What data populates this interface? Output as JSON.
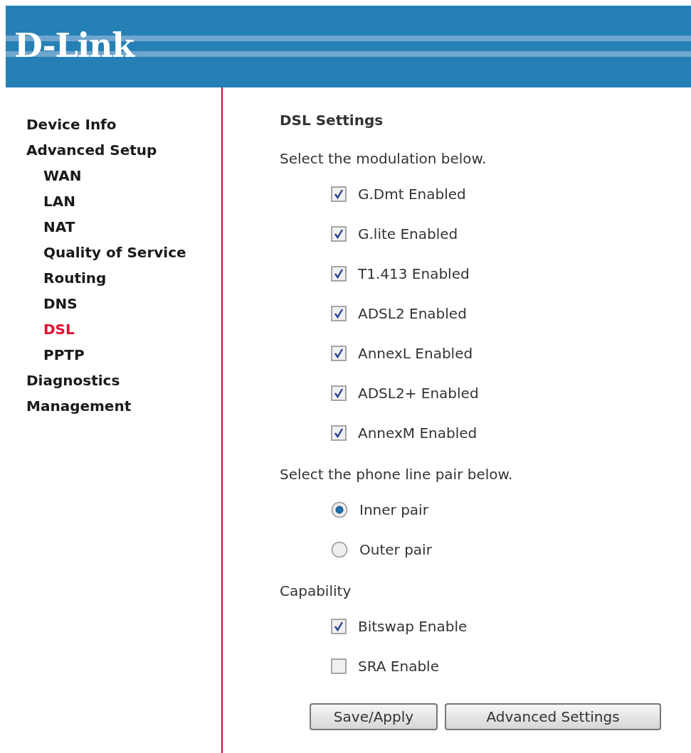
{
  "header": {
    "logo": "D-Link"
  },
  "sidebar": {
    "items": [
      {
        "label": "Device Info",
        "selected": false
      },
      {
        "label": "Advanced Setup",
        "selected": false,
        "children": [
          {
            "label": "WAN",
            "selected": false
          },
          {
            "label": "LAN",
            "selected": false
          },
          {
            "label": "NAT",
            "selected": false
          },
          {
            "label": "Quality of Service",
            "selected": false
          },
          {
            "label": "Routing",
            "selected": false
          },
          {
            "label": "DNS",
            "selected": false
          },
          {
            "label": "DSL",
            "selected": true
          },
          {
            "label": "PPTP",
            "selected": false
          }
        ]
      },
      {
        "label": "Diagnostics",
        "selected": false
      },
      {
        "label": "Management",
        "selected": false
      }
    ]
  },
  "title": "DSL Settings",
  "sections": [
    {
      "heading": "Select the modulation below.",
      "kind": "checkbox",
      "options": [
        {
          "label": "G.Dmt Enabled",
          "checked": true
        },
        {
          "label": "G.lite Enabled",
          "checked": true
        },
        {
          "label": "T1.413 Enabled",
          "checked": true
        },
        {
          "label": "ADSL2 Enabled",
          "checked": true
        },
        {
          "label": "AnnexL Enabled",
          "checked": true
        },
        {
          "label": "ADSL2+ Enabled",
          "checked": true
        },
        {
          "label": "AnnexM Enabled",
          "checked": true
        }
      ]
    },
    {
      "heading": "Select the phone line pair below.",
      "kind": "radio",
      "options": [
        {
          "label": "Inner pair",
          "selected": true
        },
        {
          "label": "Outer pair",
          "selected": false
        }
      ]
    },
    {
      "heading": "Capability",
      "kind": "checkbox",
      "options": [
        {
          "label": "Bitswap Enable",
          "checked": true
        },
        {
          "label": "SRA Enable",
          "checked": false
        }
      ]
    }
  ],
  "buttons": [
    "Save/Apply",
    "Advanced Settings"
  ]
}
